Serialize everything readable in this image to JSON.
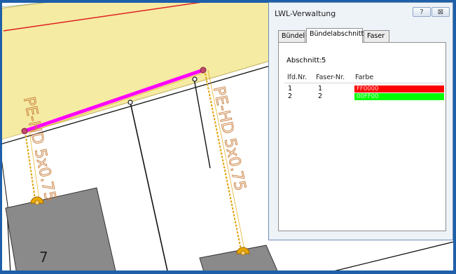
{
  "map": {
    "cable_labels": [
      "PE-HD 5x0.75",
      "PE-HD 5x0.75"
    ],
    "parcel_number": "7"
  },
  "dialog": {
    "title": "LWL-Verwaltung",
    "help_button": "?",
    "close_button": "⊠",
    "tabs": [
      "Bündel",
      "Bündelabschnitt",
      "Faser"
    ],
    "active_tab": "Bündelabschnitt",
    "section_label": "Abschnitt:",
    "section_value": "5",
    "columns": [
      "lfd.Nr.",
      "Faser-Nr.",
      "Farbe"
    ],
    "rows": [
      {
        "lfd": "1",
        "faser": "1",
        "farbe": "FF0000",
        "color": "#ff0000"
      },
      {
        "lfd": "2",
        "faser": "2",
        "farbe": "00FF00",
        "color": "#00ff00"
      }
    ]
  },
  "colors": {
    "frame": "#1f5fa9",
    "parcel_fill": "#f5eba3",
    "parcel_border": "#d7c87a",
    "cable_selected": "#ff00ff",
    "cable_line": "#e0a000",
    "building": "#8a8a8a",
    "label_text": "#c87d3c"
  }
}
